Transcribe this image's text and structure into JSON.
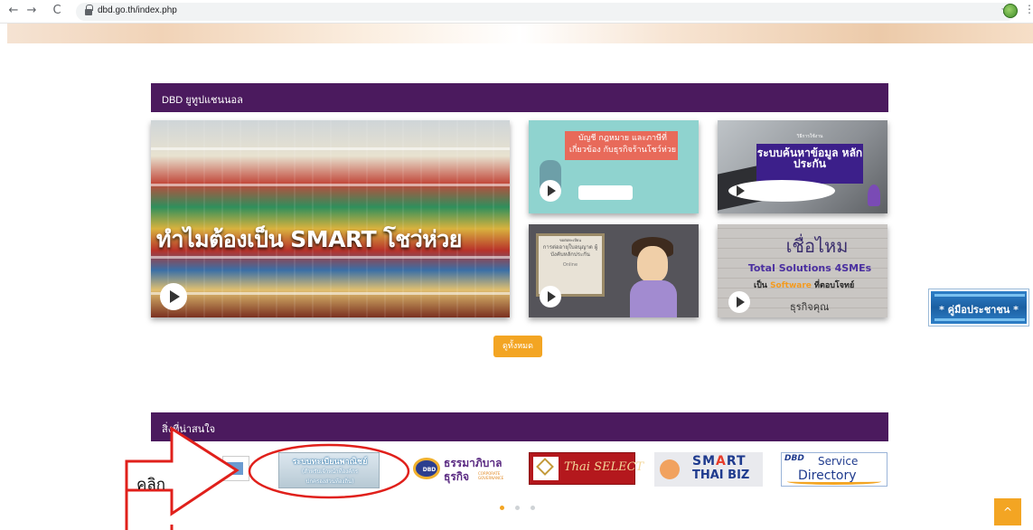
{
  "browser": {
    "back_glyph": "←",
    "forward_glyph": "→",
    "reload_glyph": "C",
    "url": "dbd.go.th/index.php",
    "bookmark_glyph": "☆",
    "menu_glyph": "⋮"
  },
  "youtube_section": {
    "title": "DBD ยูทูปแชนนอล",
    "videos": {
      "main": {
        "title": "ทำไมต้องเป็น SMART โชว่ห่วย"
      },
      "grocery_law": {
        "title": "บัญชี กฎหมาย และภาษีที่เกี่ยวข้อง กับธุรกิจร้านโชว์ห่วย"
      },
      "collateral_search": {
        "small": "วิธีการใช้งาน",
        "title": "ระบบค้นหาข้อมูล หลักประกัน"
      },
      "license_renewal": {
        "small": "ขอต่อทะเบียน",
        "title": "การต่ออายุใบอนุญาต ผู้บังคับหลักประกัน",
        "tag": "Online"
      },
      "total_solutions": {
        "title": "เชื่อไหม",
        "line2": "Total Solutions 4SMEs",
        "line3_pre": "เป็น ",
        "line3_hl": "Software",
        "line3_post": " ที่ตอบโจทย์",
        "line4": "ธุรกิจคุณ"
      }
    },
    "see_all_label": "ดูทั้งหมด"
  },
  "links_section": {
    "title": "สิ่งที่น่าสนใจ",
    "logos": {
      "registration": {
        "l1": "ระบบทะเบียนพาณิชย์",
        "l2": "(สำหรับเจ้าหน้าที่องค์กร",
        "l3": "ปกครองส่วนท้องถิ่น)"
      },
      "governance": {
        "mark": "DBD",
        "t1": "ธรรมาภิบาล",
        "t2": "ธุรกิจ",
        "t3": "CORPORATE GOVERNANCE"
      },
      "thai_select": {
        "label": "Thai SELECT"
      },
      "smart_thai_biz": {
        "t1_a": "SM",
        "t1_b": "A",
        "t1_c": "RT",
        "t2": "THAI BIZ"
      },
      "service_directory": {
        "t1": "DBD",
        "t2": "Service",
        "t3": "Directory"
      }
    }
  },
  "annotation": {
    "label": "คลิก",
    "color": "#e0201b"
  },
  "help_badge": {
    "label": "* คู่มือประชาชน *"
  },
  "to_top_glyph": "^",
  "colors": {
    "section_bar": "#4b1a5e",
    "accent": "#f3a523"
  }
}
